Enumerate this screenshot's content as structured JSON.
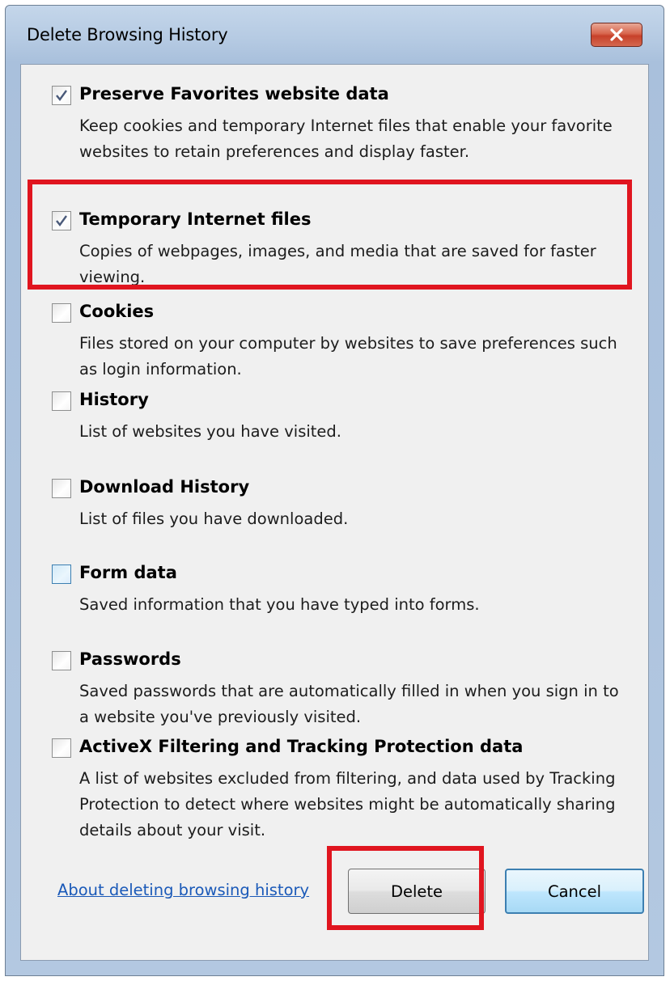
{
  "window": {
    "title": "Delete Browsing History",
    "close_icon": "close-icon"
  },
  "options": [
    {
      "id": "preserve-favorites",
      "label": "Preserve Favorites website data",
      "description": "Keep cookies and temporary Internet files that enable your favorite websites to retain preferences and display faster.",
      "checked": true
    },
    {
      "id": "temporary-internet-files",
      "label": "Temporary Internet files",
      "description": "Copies of webpages, images, and media that are saved for faster viewing.",
      "checked": true,
      "highlighted": true
    },
    {
      "id": "cookies",
      "label": "Cookies",
      "description": "Files stored on your computer by websites to save preferences such as login information.",
      "checked": false
    },
    {
      "id": "history",
      "label": "History",
      "description": "List of websites you have visited.",
      "checked": false
    },
    {
      "id": "download-history",
      "label": "Download History",
      "description": "List of files you have downloaded.",
      "checked": false
    },
    {
      "id": "form-data",
      "label": "Form data",
      "description": "Saved information that you have typed into forms.",
      "checked": false,
      "focused": true
    },
    {
      "id": "passwords",
      "label": "Passwords",
      "description": "Saved passwords that are automatically filled in when you sign in to a website you've previously visited.",
      "checked": false
    },
    {
      "id": "activex-filtering",
      "label": "ActiveX Filtering and Tracking Protection data",
      "description": "A list of websites excluded from filtering, and data used by Tracking Protection to detect where websites might be automatically sharing details about your visit.",
      "checked": false
    }
  ],
  "footer": {
    "link_text": "About deleting browsing history",
    "delete_label": "Delete",
    "cancel_label": "Cancel",
    "delete_highlighted": true
  },
  "colors": {
    "highlight": "#e0151f",
    "link": "#1a59b8",
    "dialog_background": "#f0f0f0"
  }
}
